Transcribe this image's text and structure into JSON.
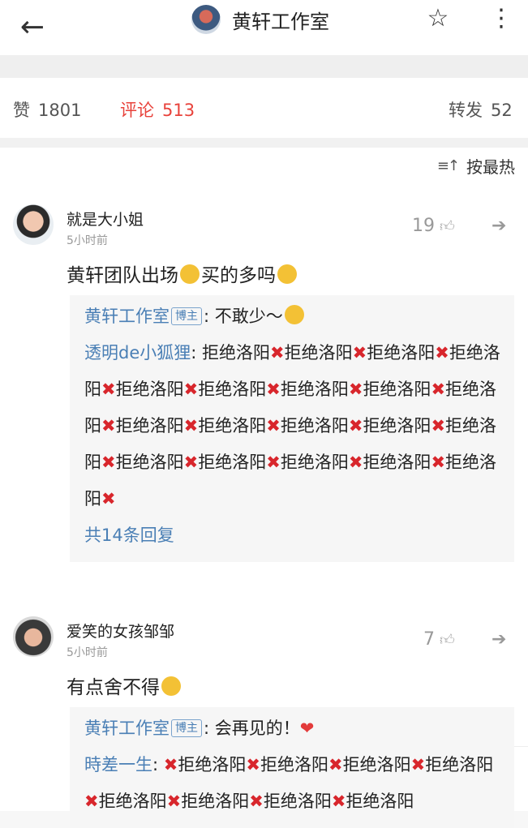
{
  "header": {
    "back_icon": "arrow-left-icon",
    "title": "黄轩工作室",
    "star_icon": "star-outline-icon",
    "more_icon": "vertical-dots-icon"
  },
  "stats": {
    "like_label": "赞",
    "like_count": "1801",
    "comment_label": "评论",
    "comment_count": "513",
    "repost_label": "转发",
    "repost_count": "52",
    "active_color": "#e8423b"
  },
  "sort": {
    "icon": "sort-lines-icon",
    "label": "按最热"
  },
  "comments": [
    {
      "name": "就是大小姐",
      "time": "5小时前",
      "likes": "19",
      "text_before": "黄轩团队出场",
      "text_middle": "买的多吗",
      "reply1_name": "黄轩工作室",
      "reply1_tag": "博主",
      "reply1_text": ": 不敢少～",
      "reply2_name": "透明de小狐狸",
      "reply2_sep": ": ",
      "reply2_repeat": "拒绝洛阳",
      "more_replies": "共14条回复"
    },
    {
      "name": "爱笑的女孩邹邹",
      "time": "5小时前",
      "likes": "7",
      "text": "有点舍不得",
      "reply1_name": "黄轩工作室",
      "reply1_tag": "博主",
      "reply1_text": ": 会再见的！",
      "reply2_name": "時差一生",
      "reply2_sep": ": ",
      "reply2_repeat": "拒绝洛阳"
    }
  ]
}
